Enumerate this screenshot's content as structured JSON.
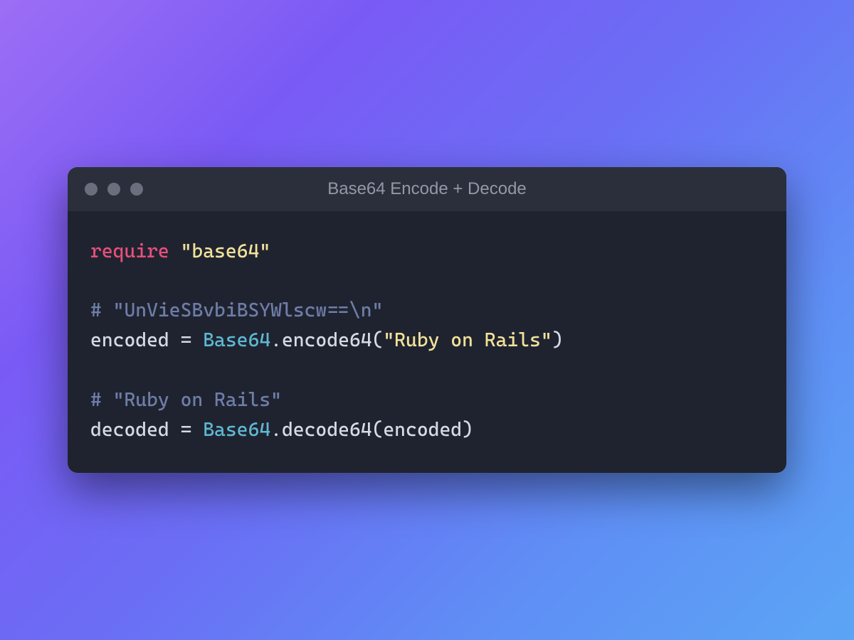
{
  "window": {
    "title": "Base64 Encode + Decode"
  },
  "code": {
    "l1_require": "require",
    "l1_string": "\"base64\"",
    "l3_comment": "# \"UnVieSBvbiBSYWlscw==\\n\"",
    "l4_var": "encoded",
    "l4_eq": " = ",
    "l4_class": "Base64",
    "l4_dot": ".",
    "l4_fn": "encode64",
    "l4_open": "(",
    "l4_arg": "\"Ruby on Rails\"",
    "l4_close": ")",
    "l6_comment": "# \"Ruby on Rails\"",
    "l7_var": "decoded",
    "l7_eq": " = ",
    "l7_class": "Base64",
    "l7_dot": ".",
    "l7_fn": "decode64",
    "l7_open": "(",
    "l7_arg": "encoded",
    "l7_close": ")"
  }
}
